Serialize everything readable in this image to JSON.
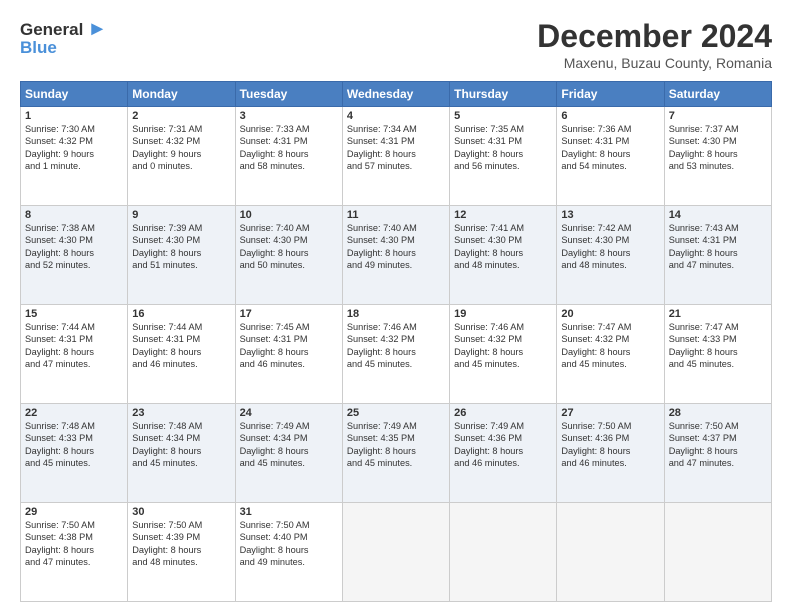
{
  "logo": {
    "line1": "General",
    "line2": "Blue",
    "arrow": "▶"
  },
  "title": "December 2024",
  "subtitle": "Maxenu, Buzau County, Romania",
  "calendar": {
    "headers": [
      "Sunday",
      "Monday",
      "Tuesday",
      "Wednesday",
      "Thursday",
      "Friday",
      "Saturday"
    ],
    "rows": [
      [
        {
          "day": "1",
          "info": "Sunrise: 7:30 AM\nSunset: 4:32 PM\nDaylight: 9 hours\nand 1 minute."
        },
        {
          "day": "2",
          "info": "Sunrise: 7:31 AM\nSunset: 4:32 PM\nDaylight: 9 hours\nand 0 minutes."
        },
        {
          "day": "3",
          "info": "Sunrise: 7:33 AM\nSunset: 4:31 PM\nDaylight: 8 hours\nand 58 minutes."
        },
        {
          "day": "4",
          "info": "Sunrise: 7:34 AM\nSunset: 4:31 PM\nDaylight: 8 hours\nand 57 minutes."
        },
        {
          "day": "5",
          "info": "Sunrise: 7:35 AM\nSunset: 4:31 PM\nDaylight: 8 hours\nand 56 minutes."
        },
        {
          "day": "6",
          "info": "Sunrise: 7:36 AM\nSunset: 4:31 PM\nDaylight: 8 hours\nand 54 minutes."
        },
        {
          "day": "7",
          "info": "Sunrise: 7:37 AM\nSunset: 4:30 PM\nDaylight: 8 hours\nand 53 minutes."
        }
      ],
      [
        {
          "day": "8",
          "info": "Sunrise: 7:38 AM\nSunset: 4:30 PM\nDaylight: 8 hours\nand 52 minutes."
        },
        {
          "day": "9",
          "info": "Sunrise: 7:39 AM\nSunset: 4:30 PM\nDaylight: 8 hours\nand 51 minutes."
        },
        {
          "day": "10",
          "info": "Sunrise: 7:40 AM\nSunset: 4:30 PM\nDaylight: 8 hours\nand 50 minutes."
        },
        {
          "day": "11",
          "info": "Sunrise: 7:40 AM\nSunset: 4:30 PM\nDaylight: 8 hours\nand 49 minutes."
        },
        {
          "day": "12",
          "info": "Sunrise: 7:41 AM\nSunset: 4:30 PM\nDaylight: 8 hours\nand 48 minutes."
        },
        {
          "day": "13",
          "info": "Sunrise: 7:42 AM\nSunset: 4:30 PM\nDaylight: 8 hours\nand 48 minutes."
        },
        {
          "day": "14",
          "info": "Sunrise: 7:43 AM\nSunset: 4:31 PM\nDaylight: 8 hours\nand 47 minutes."
        }
      ],
      [
        {
          "day": "15",
          "info": "Sunrise: 7:44 AM\nSunset: 4:31 PM\nDaylight: 8 hours\nand 47 minutes."
        },
        {
          "day": "16",
          "info": "Sunrise: 7:44 AM\nSunset: 4:31 PM\nDaylight: 8 hours\nand 46 minutes."
        },
        {
          "day": "17",
          "info": "Sunrise: 7:45 AM\nSunset: 4:31 PM\nDaylight: 8 hours\nand 46 minutes."
        },
        {
          "day": "18",
          "info": "Sunrise: 7:46 AM\nSunset: 4:32 PM\nDaylight: 8 hours\nand 45 minutes."
        },
        {
          "day": "19",
          "info": "Sunrise: 7:46 AM\nSunset: 4:32 PM\nDaylight: 8 hours\nand 45 minutes."
        },
        {
          "day": "20",
          "info": "Sunrise: 7:47 AM\nSunset: 4:32 PM\nDaylight: 8 hours\nand 45 minutes."
        },
        {
          "day": "21",
          "info": "Sunrise: 7:47 AM\nSunset: 4:33 PM\nDaylight: 8 hours\nand 45 minutes."
        }
      ],
      [
        {
          "day": "22",
          "info": "Sunrise: 7:48 AM\nSunset: 4:33 PM\nDaylight: 8 hours\nand 45 minutes."
        },
        {
          "day": "23",
          "info": "Sunrise: 7:48 AM\nSunset: 4:34 PM\nDaylight: 8 hours\nand 45 minutes."
        },
        {
          "day": "24",
          "info": "Sunrise: 7:49 AM\nSunset: 4:34 PM\nDaylight: 8 hours\nand 45 minutes."
        },
        {
          "day": "25",
          "info": "Sunrise: 7:49 AM\nSunset: 4:35 PM\nDaylight: 8 hours\nand 45 minutes."
        },
        {
          "day": "26",
          "info": "Sunrise: 7:49 AM\nSunset: 4:36 PM\nDaylight: 8 hours\nand 46 minutes."
        },
        {
          "day": "27",
          "info": "Sunrise: 7:50 AM\nSunset: 4:36 PM\nDaylight: 8 hours\nand 46 minutes."
        },
        {
          "day": "28",
          "info": "Sunrise: 7:50 AM\nSunset: 4:37 PM\nDaylight: 8 hours\nand 47 minutes."
        }
      ],
      [
        {
          "day": "29",
          "info": "Sunrise: 7:50 AM\nSunset: 4:38 PM\nDaylight: 8 hours\nand 47 minutes."
        },
        {
          "day": "30",
          "info": "Sunrise: 7:50 AM\nSunset: 4:39 PM\nDaylight: 8 hours\nand 48 minutes."
        },
        {
          "day": "31",
          "info": "Sunrise: 7:50 AM\nSunset: 4:40 PM\nDaylight: 8 hours\nand 49 minutes."
        },
        {
          "day": "",
          "info": ""
        },
        {
          "day": "",
          "info": ""
        },
        {
          "day": "",
          "info": ""
        },
        {
          "day": "",
          "info": ""
        }
      ]
    ]
  }
}
